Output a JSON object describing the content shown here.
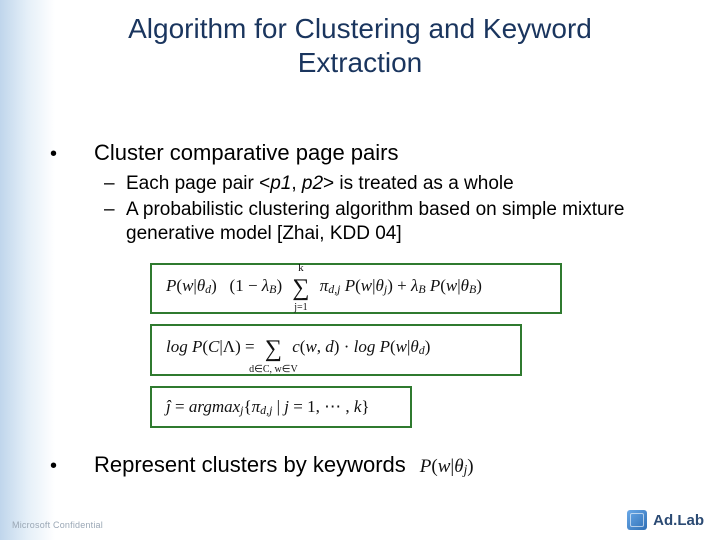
{
  "title": "Algorithm for Clustering and Keyword Extraction",
  "bullets": {
    "b1": {
      "text": "Cluster comparative page pairs",
      "sub": [
        {
          "pre": "Each page pair <",
          "p1": "p1",
          "mid": ", ",
          "p2": "p2",
          "post": "> is treated as a whole"
        },
        {
          "full": "A probabilistic clustering algorithm based on simple mixture generative model [Zhai, KDD 04]"
        }
      ]
    },
    "b2": {
      "text": "Represent clusters by keywords",
      "formula": "P(w|θj)"
    }
  },
  "formulas": {
    "f1": {
      "lhs": "P(w|θd) = (1 − λB)",
      "sum_lower": "j=1",
      "sum_upper": "k",
      "inner": "πd,j P(w|θj) + λB P(w|θB)"
    },
    "f2": {
      "lhs": "log P(C|Λ) =",
      "sum_lower": "d∈C, w∈V",
      "rhs": "c(w, d) · log P(w|θd)"
    },
    "f3": {
      "text": "ĵ = argmaxj {πd,j | j = 1, ⋯ , k}"
    }
  },
  "footer": {
    "left": "Microsoft Confidential",
    "logo": "Ad.Lab"
  }
}
